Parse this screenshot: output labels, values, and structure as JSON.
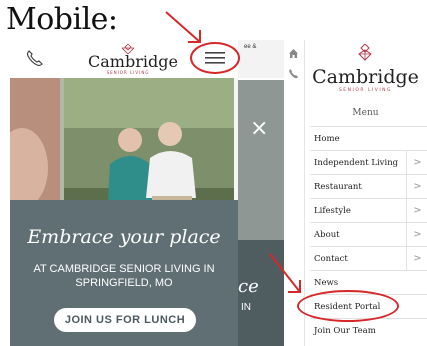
{
  "heading": "Mobile:",
  "left_screen": {
    "brand": "Cambridge",
    "brand_tagline": "SENIOR LIVING",
    "hero_script": "Embrace your place",
    "hero_subtitle": "AT CAMBRIDGE SENIOR LIVING IN SPRINGFIELD, MO",
    "cta_label": "JOIN US FOR LUNCH"
  },
  "middle_screen": {
    "top_text": "ee &",
    "close_glyph": "×",
    "script_fragment": "ce",
    "text_fragment": "IN"
  },
  "right_screen": {
    "brand": "Cambridge",
    "brand_tagline": "SENIOR LIVING",
    "menu_title": "Menu",
    "items": [
      {
        "label": "Home",
        "has_submenu": false
      },
      {
        "label": "Independent Living",
        "has_submenu": true
      },
      {
        "label": "Restaurant",
        "has_submenu": true
      },
      {
        "label": "Lifestyle",
        "has_submenu": true
      },
      {
        "label": "About",
        "has_submenu": true
      },
      {
        "label": "Contact",
        "has_submenu": true
      },
      {
        "label": "News",
        "has_submenu": false
      },
      {
        "label": "Resident Portal",
        "has_submenu": false
      },
      {
        "label": "Join Our Team",
        "has_submenu": false
      }
    ],
    "chevron_glyph": ">"
  },
  "colors": {
    "annotation": "#d62828",
    "brand_accent": "#b4384a",
    "hero_card": "#5f6f74"
  }
}
